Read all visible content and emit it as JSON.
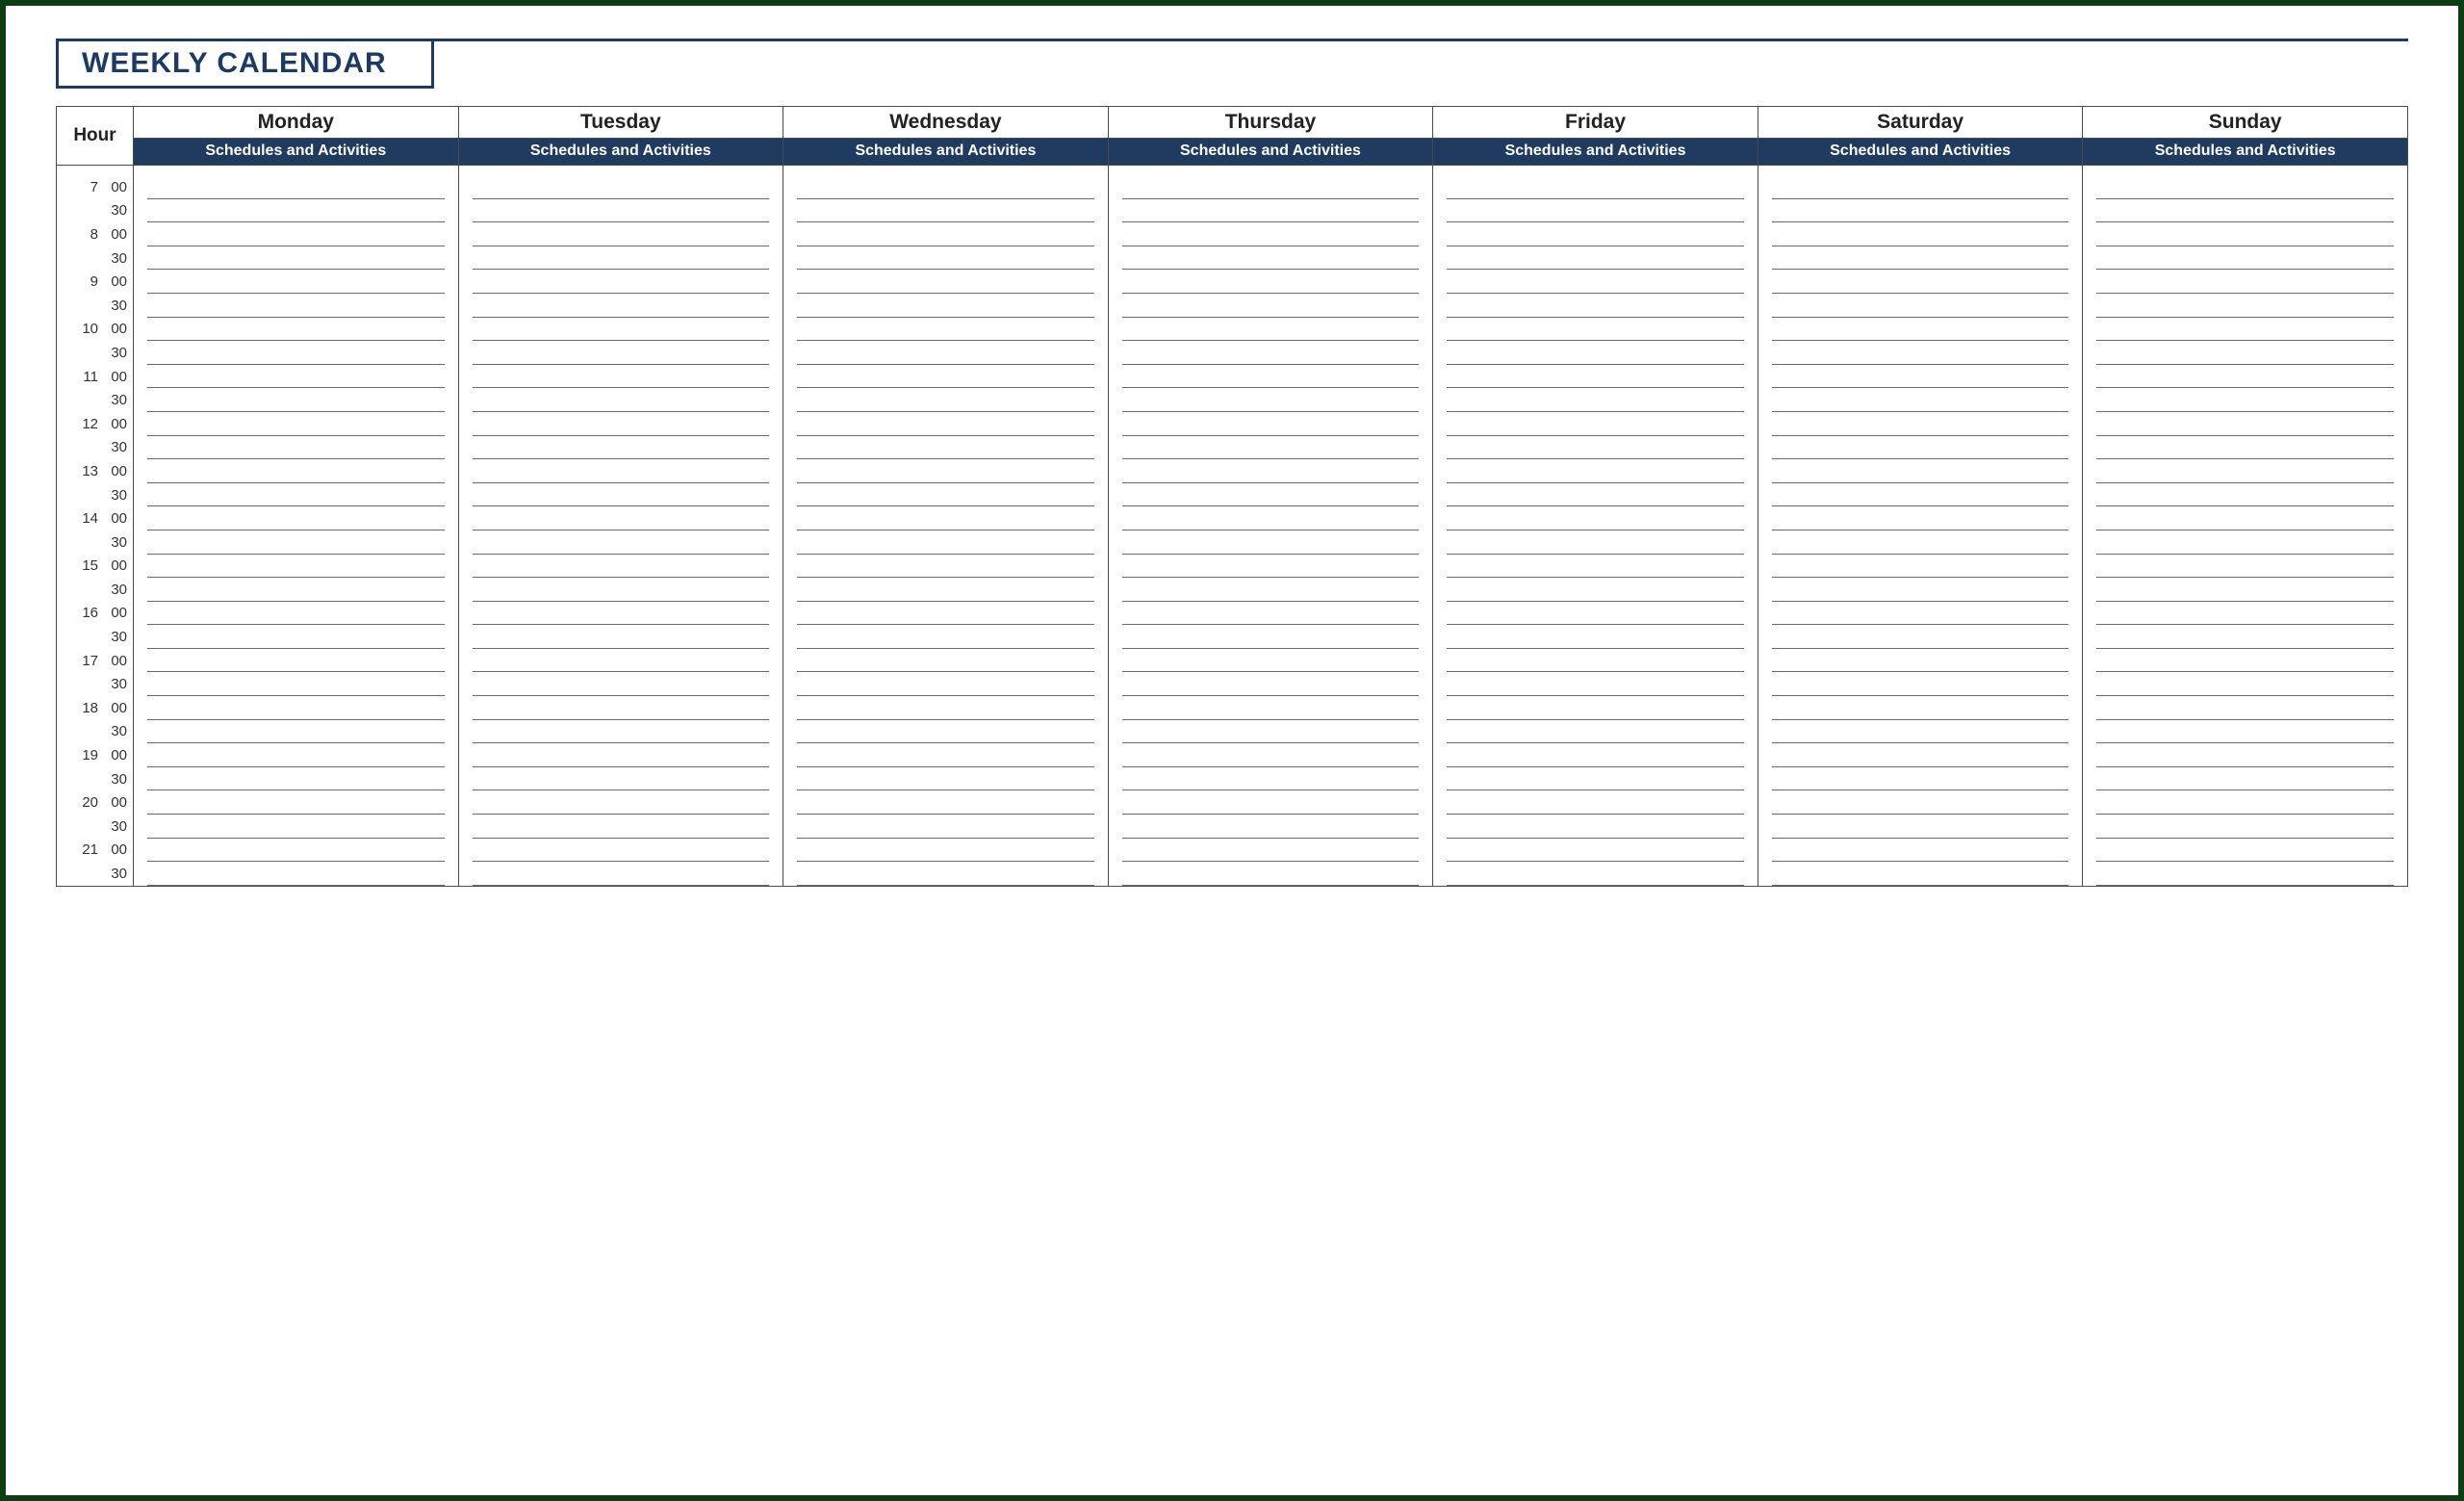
{
  "title": "WEEKLY CALENDAR",
  "hour_header": "Hour",
  "days": [
    "Monday",
    "Tuesday",
    "Wednesday",
    "Thursday",
    "Friday",
    "Saturday",
    "Sunday"
  ],
  "sub_header": "Schedules and Activities",
  "hours": [
    7,
    8,
    9,
    10,
    11,
    12,
    13,
    14,
    15,
    16,
    17,
    18,
    19,
    20,
    21
  ],
  "minutes": [
    "00",
    "30"
  ],
  "colors": {
    "frame": "#0e3d14",
    "accent": "#1b3a66",
    "band": "#1f3b60"
  }
}
